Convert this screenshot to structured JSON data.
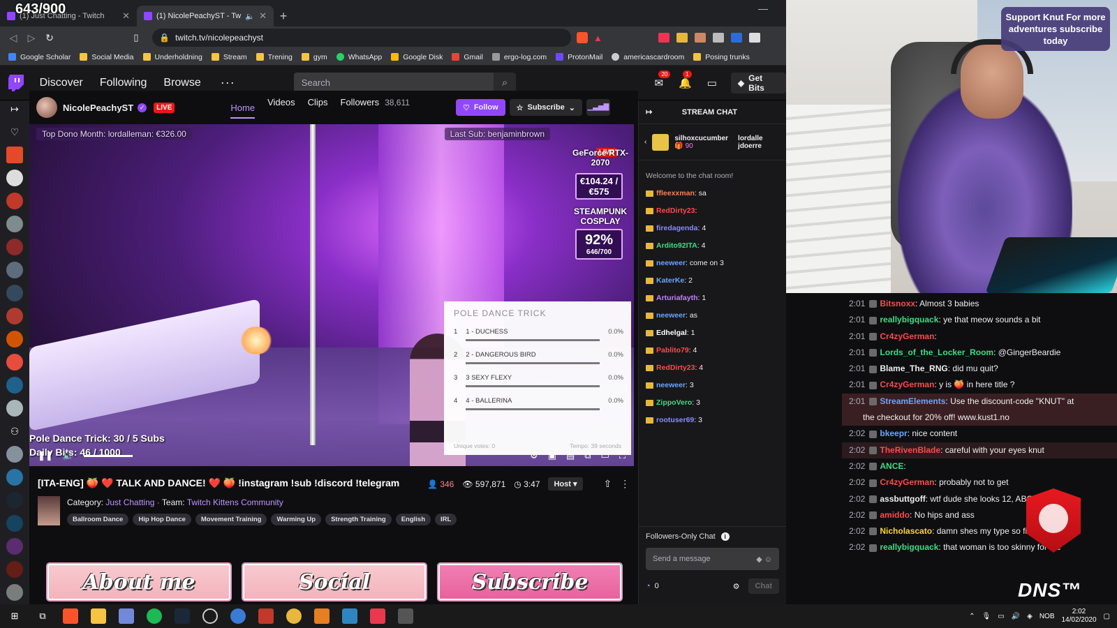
{
  "overlay_counter": "643/900",
  "tabs": [
    {
      "label": "(1) Just Chatting - Twitch",
      "active": false
    },
    {
      "label": "(1) NicolePeachyST - Twitch",
      "active": true
    }
  ],
  "address": {
    "url": "twitch.tv/nicolepeachyst"
  },
  "bookmarks": [
    {
      "label": "Google Scholar",
      "color": "#4285f4"
    },
    {
      "label": "Social Media",
      "color": "#f6c342"
    },
    {
      "label": "Underholdning",
      "color": "#f6c342"
    },
    {
      "label": "Stream",
      "color": "#f6c342"
    },
    {
      "label": "Trening",
      "color": "#f6c342"
    },
    {
      "label": "gym",
      "color": "#f6c342"
    },
    {
      "label": "WhatsApp",
      "color": "#25d366"
    },
    {
      "label": "Google Disk",
      "color": "#fbbc04"
    },
    {
      "label": "Gmail",
      "color": "#ea4335"
    },
    {
      "label": "ergo-log.com",
      "color": "#999999"
    },
    {
      "label": "ProtonMail",
      "color": "#6d4aff"
    },
    {
      "label": "americascardroom",
      "color": "#cccccc"
    },
    {
      "label": "Posing trunks",
      "color": "#f6c342"
    }
  ],
  "twitch_nav": {
    "links": [
      "Discover",
      "Following",
      "Browse"
    ],
    "more": "···",
    "search_placeholder": "Search",
    "inbox_badge": "20",
    "notif_badge": "1",
    "get_bits": "Get Bits"
  },
  "channel": {
    "name": "NicolePeachyST",
    "live": "LIVE",
    "tabs": [
      "Home",
      "Videos",
      "Clips",
      "Followers"
    ],
    "followers_count": "38,611",
    "follow": "Follow",
    "subscribe": "Subscribe"
  },
  "video": {
    "top_left": "Top Dono Month: lordalleman: €326.00",
    "top_right": "Last Sub: benjaminbrown",
    "live": "LIVE",
    "goal1": {
      "label": "GeForce RTX-2070",
      "value": "€104.24 /€575"
    },
    "goal2": {
      "label": "STEAMPUNK COSPLAY",
      "pct": "92%",
      "count": "646/700"
    },
    "ticker1": "Pole Dance Trick: 30 / 5 Subs",
    "ticker2": "Daily Bits: 46 / 1000",
    "poll": {
      "title": "POLE DANCE TRICK",
      "options": [
        {
          "num": "1",
          "label": "1 - DUCHESS",
          "pct": "0.0%"
        },
        {
          "num": "2",
          "label": "2 - DANGEROUS BIRD",
          "pct": "0.0%"
        },
        {
          "num": "3",
          "label": "3 SEXY FLEXY",
          "pct": "0.0%"
        },
        {
          "num": "4",
          "label": "4 - BALLERINA",
          "pct": "0.0%"
        }
      ],
      "unique_votes": "Unique votes: 0",
      "time": "Tempo: 39 seconds"
    }
  },
  "stream": {
    "title": "[ITA-ENG] 🍑 ❤️ TALK AND DANCE! ❤️ 🍑 !instagram !sub !discord !telegram",
    "viewers": "346",
    "views": "597,871",
    "uptime": "3:47",
    "host": "Host",
    "category_label": "Category:",
    "category": "Just Chatting",
    "team_label": "Team:",
    "team": "Twitch Kittens Community",
    "tags": [
      "Ballroom Dance",
      "Hip Hop Dance",
      "Movement Training",
      "Warming Up",
      "Strength Training",
      "English",
      "IRL"
    ]
  },
  "panels": [
    "About me",
    "Social",
    "Subscribe"
  ],
  "chat": {
    "title": "STREAM CHAT",
    "gifter1": "silhoxcucumber",
    "gifter1_count": "90",
    "gifter2": "lordalle",
    "gifter3": "jdoerre",
    "welcome": "Welcome to the chat room!",
    "messages": [
      {
        "user": "ffleexxman",
        "text": ": sa",
        "color": "#ff7f50"
      },
      {
        "user": "RedDirty23",
        "text": ":",
        "color": "#ff4a4a"
      },
      {
        "user": "firedagenda",
        "text": ": 4",
        "color": "#8a8aff"
      },
      {
        "user": "Ardito92ITA",
        "text": ": 4",
        "color": "#3ddc84"
      },
      {
        "user": "neeweer",
        "text": ": come on 3",
        "color": "#6aa4ff"
      },
      {
        "user": "KaterKe",
        "text": ": 2",
        "color": "#6aa4ff"
      },
      {
        "user": "Arturiafayth",
        "text": ": 1",
        "color": "#c080ff"
      },
      {
        "user": "neeweer",
        "text": ": as",
        "color": "#6aa4ff"
      },
      {
        "user": "Edhelgal",
        "text": ": 1",
        "color": "#ffffff"
      },
      {
        "user": "Pablito79",
        "text": ": 4",
        "color": "#ff4a4a"
      },
      {
        "user": "RedDirty23",
        "text": ": 4",
        "color": "#ff4a4a"
      },
      {
        "user": "neeweer",
        "text": ": 3",
        "color": "#6aa4ff"
      },
      {
        "user": "ZippoVero",
        "text": ": 3",
        "color": "#3ddc84"
      },
      {
        "user": "rootuser69",
        "text": ": 3",
        "color": "#8a8aff"
      }
    ],
    "followers_only": "Followers-Only Chat",
    "input_placeholder": "Send a message",
    "points": "0",
    "chat_button": "Chat"
  },
  "cam": {
    "support": "Support Knut For more adventures subscribe today"
  },
  "right_chat": [
    {
      "time": "2:01",
      "user": "Bitsnoxx",
      "text": ": Almost 3 babies",
      "color": "#ff4a4a",
      "hl": ""
    },
    {
      "time": "2:01",
      "user": "reallybigquack",
      "text": ": ye that meow sounds a bit",
      "color": "#3ddc84",
      "hl": ""
    },
    {
      "time": "2:01",
      "user": "Cr4zyGerman",
      "text": ":",
      "color": "#ff4a4a",
      "hl": ""
    },
    {
      "time": "2:01",
      "user": "Lords_of_the_Locker_Room",
      "text": ": @GingerBeardie",
      "color": "#3ddc84",
      "hl": ""
    },
    {
      "time": "2:01",
      "user": "Blame_The_RNG",
      "text": ": did mu quit?",
      "color": "#efeff1",
      "hl": ""
    },
    {
      "time": "2:01",
      "user": "Cr4zyGerman",
      "text": ": y is 🍑 in here title ?",
      "color": "#ff4a4a",
      "hl": ""
    },
    {
      "time": "2:01",
      "user": "StreamElements",
      "text": ": Use the discount-code \"KNUT\" at",
      "color": "#6aa4ff",
      "hl": "hl"
    },
    {
      "time": "",
      "user": "",
      "text": "the checkout for 20% off! www.kust1.no",
      "color": "#efeff1",
      "hl": "hl"
    },
    {
      "time": "2:02",
      "user": "bkeepr",
      "text": ": nice content",
      "color": "#6aa4ff",
      "hl": ""
    },
    {
      "time": "2:02",
      "user": "TheRivenBlade",
      "text": ": careful with your eyes knut",
      "color": "#ff4a4a",
      "hl": "hl2"
    },
    {
      "time": "2:02",
      "user": "ANCE",
      "text": ":",
      "color": "#3ddc84",
      "hl": ""
    },
    {
      "time": "2:02",
      "user": "Cr4zyGerman",
      "text": ": probably not to get",
      "color": "#ff4a4a",
      "hl": ""
    },
    {
      "time": "2:02",
      "user": "assbuttgoff",
      "text": ": wtf dude she looks 12, ABOR",
      "color": "#efeff1",
      "hl": ""
    },
    {
      "time": "2:02",
      "user": "amiddo",
      "text": ": No hips and ass",
      "color": "#ff4a4a",
      "hl": ""
    },
    {
      "time": "2:02",
      "user": "Nicholascato",
      "text": ": damn shes my type so fit 10/10",
      "color": "#ffd23f",
      "hl": ""
    },
    {
      "time": "2:02",
      "user": "reallybigquack",
      "text": ": that woman is too skinny for me",
      "color": "#3ddc84",
      "hl": ""
    }
  ],
  "dns_logo": "DNS™",
  "tray": {
    "lang": "NOB",
    "time": "2:02",
    "date": "14/02/2020"
  }
}
